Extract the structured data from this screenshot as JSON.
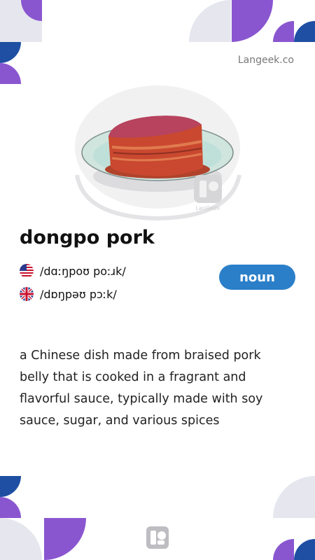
{
  "brand": "Langeek.co",
  "word": "dongpo pork",
  "pronunciations": [
    {
      "region": "us-flag-icon",
      "ipa": "/dɑːŋpoʊ poːɹk/"
    },
    {
      "region": "uk-flag-icon",
      "ipa": "/dɒŋpəʊ pɔːk/"
    }
  ],
  "part_of_speech": "noun",
  "definition": "a Chinese dish made from braised pork belly that is cooked in a fragrant and flavorful sauce, typically made with soy sauce, sugar, and various spices",
  "image_watermark": "LanGeek",
  "colors": {
    "accent_blue": "#2b7fc9",
    "purple": "#8a56d0",
    "navy": "#1f4fa3",
    "light_gray": "#e6e7ee"
  }
}
